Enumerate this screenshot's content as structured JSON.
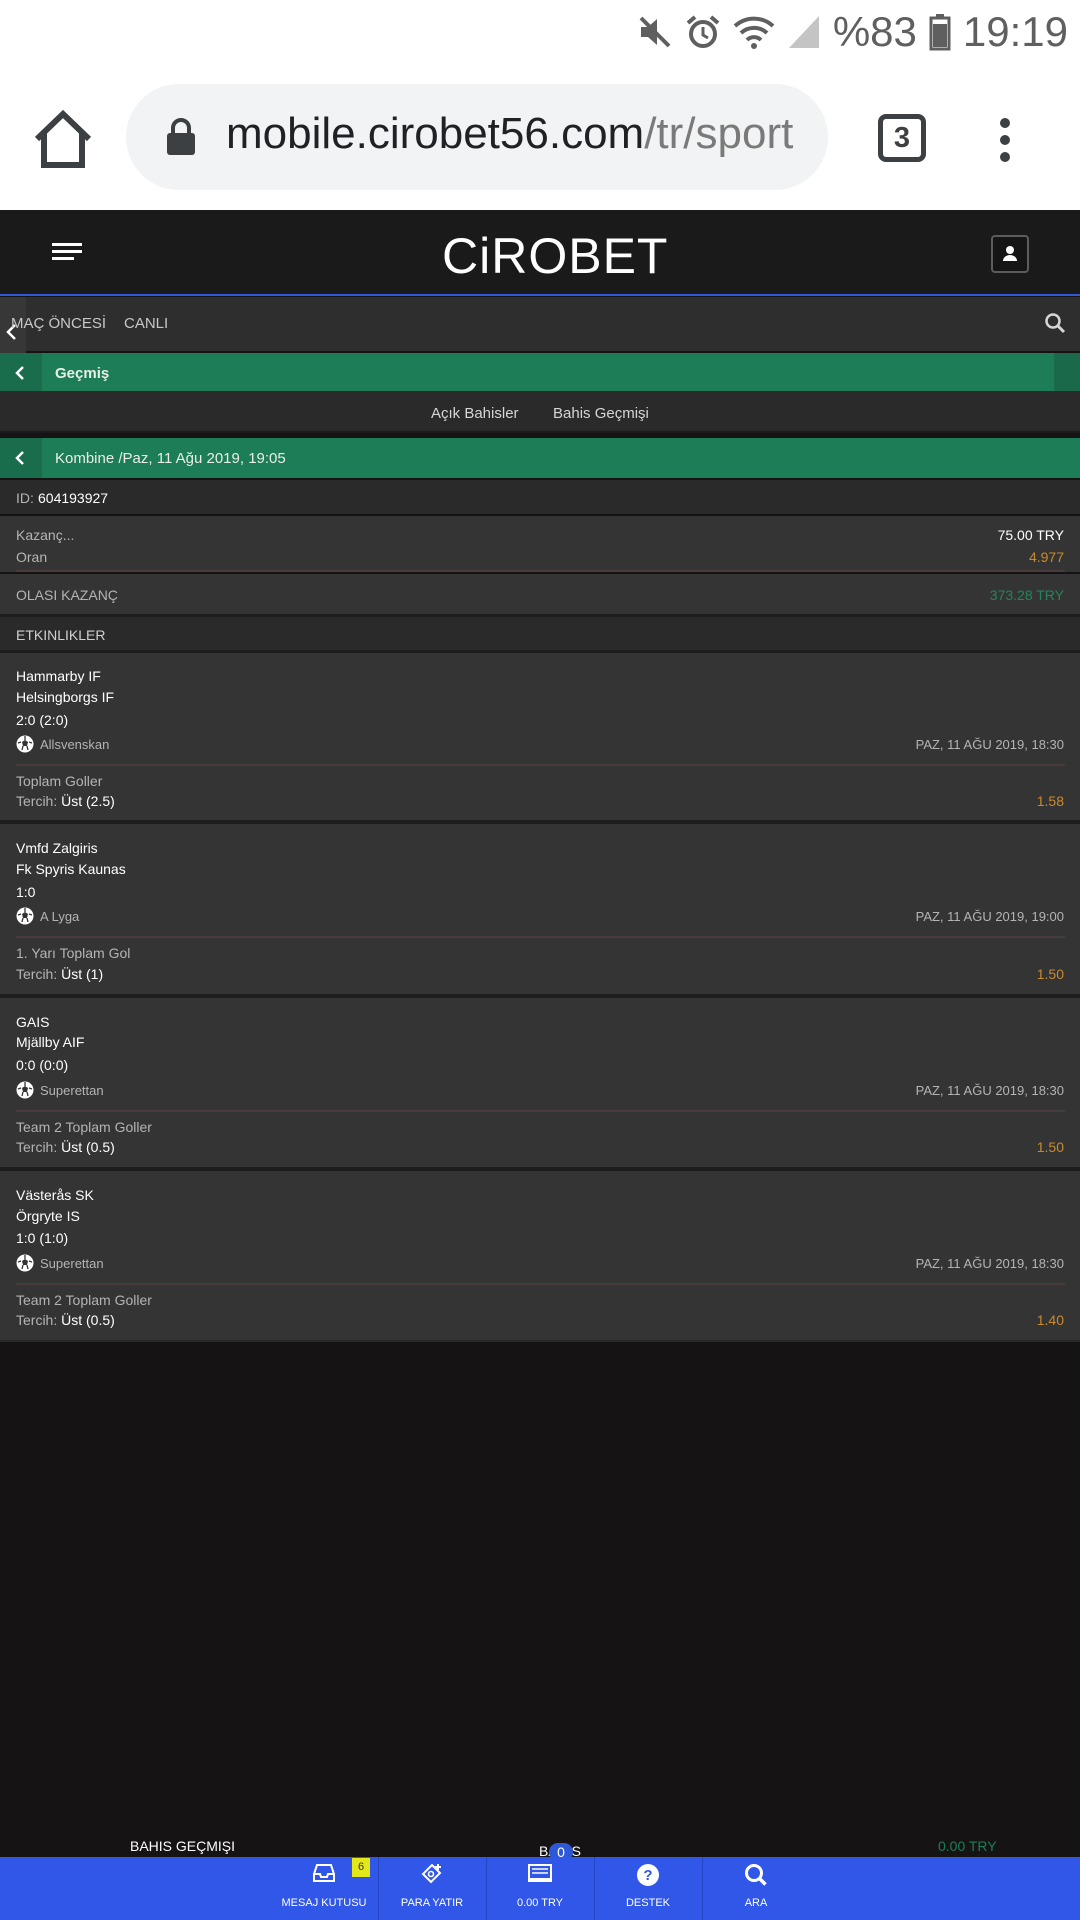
{
  "status_bar": {
    "battery": "%83",
    "time": "19:19"
  },
  "browser": {
    "url_host": "mobile.cirobet56.com",
    "url_path": "/tr/sport",
    "tab_count": "3"
  },
  "header": {
    "logo_left": "CiR",
    "logo_o": "O",
    "logo_right": "BET"
  },
  "subnav": {
    "items": [
      "MAÇ ÖNCESİ",
      "CANLI"
    ]
  },
  "history_bar": {
    "title": "Geçmiş"
  },
  "bet_tabs": [
    "Açık Bahisler",
    "Bahis Geçmişi"
  ],
  "bet": {
    "title": "Kombine /Paz, 11 Ağu 2019, 19:05",
    "id_label": "ID:",
    "id_value": "604193927",
    "stake_label": "Kazanç...",
    "stake_value": "75.00 TRY",
    "odds_label": "Oran",
    "odds_value": "4.977",
    "potential_label": "OLASI KAZANÇ",
    "potential_value": "373.28 TRY",
    "events_label": "ETKINLIKLER"
  },
  "events": [
    {
      "home": "Hammarby IF",
      "away": "Helsingborgs IF",
      "score": "2:0 (2:0)",
      "league": "Allsvenskan",
      "date": "PAZ, 11 AĞU 2019, 18:30",
      "market": "Toplam Goller",
      "pick_label": "Tercih:",
      "pick": "Üst (2.5)",
      "odd": "1.58"
    },
    {
      "home": "Vmfd Zalgiris",
      "away": "Fk Spyris Kaunas",
      "score": "1:0",
      "league": "A Lyga",
      "date": "PAZ, 11 AĞU 2019, 19:00",
      "market": "1. Yarı Toplam Gol",
      "pick_label": "Tercih:",
      "pick": "Üst (1)",
      "odd": "1.50"
    },
    {
      "home": "GAIS",
      "away": "Mjällby AIF",
      "score": "0:0 (0:0)",
      "league": "Superettan",
      "date": "PAZ, 11 AĞU 2019, 18:30",
      "market": "Team 2 Toplam Goller",
      "pick_label": "Tercih:",
      "pick": "Üst (0.5)",
      "odd": "1.50"
    },
    {
      "home": "Västerås SK",
      "away": "Örgryte IS",
      "score": "1:0 (1:0)",
      "league": "Superettan",
      "date": "PAZ, 11 AĞU 2019, 18:30",
      "market": "Team 2 Toplam Goller",
      "pick_label": "Tercih:",
      "pick": "Üst (0.5)",
      "odd": "1.40"
    }
  ],
  "bottom_bar": {
    "history": "BAHIS GEÇMIŞI",
    "coupon": "BAHIS KUPONU",
    "coupon_count": "0",
    "balance": "0.00 TRY"
  },
  "dock": {
    "items": [
      {
        "label": "MESAJ KUTUSU",
        "icon": "inbox-icon"
      },
      {
        "label": "PARA YATIR",
        "icon": "deposit-icon"
      },
      {
        "label": "0.00 TRY",
        "icon": "wallet-icon"
      },
      {
        "label": "DESTEK",
        "icon": "help-icon"
      },
      {
        "label": "ARA",
        "icon": "search-icon"
      }
    ],
    "message_count": "6"
  },
  "colors": {
    "accent_blue": "#3057e7",
    "green_bar": "#1d7d56",
    "odd_orange": "#c98a2b",
    "win_green": "#23855d"
  }
}
